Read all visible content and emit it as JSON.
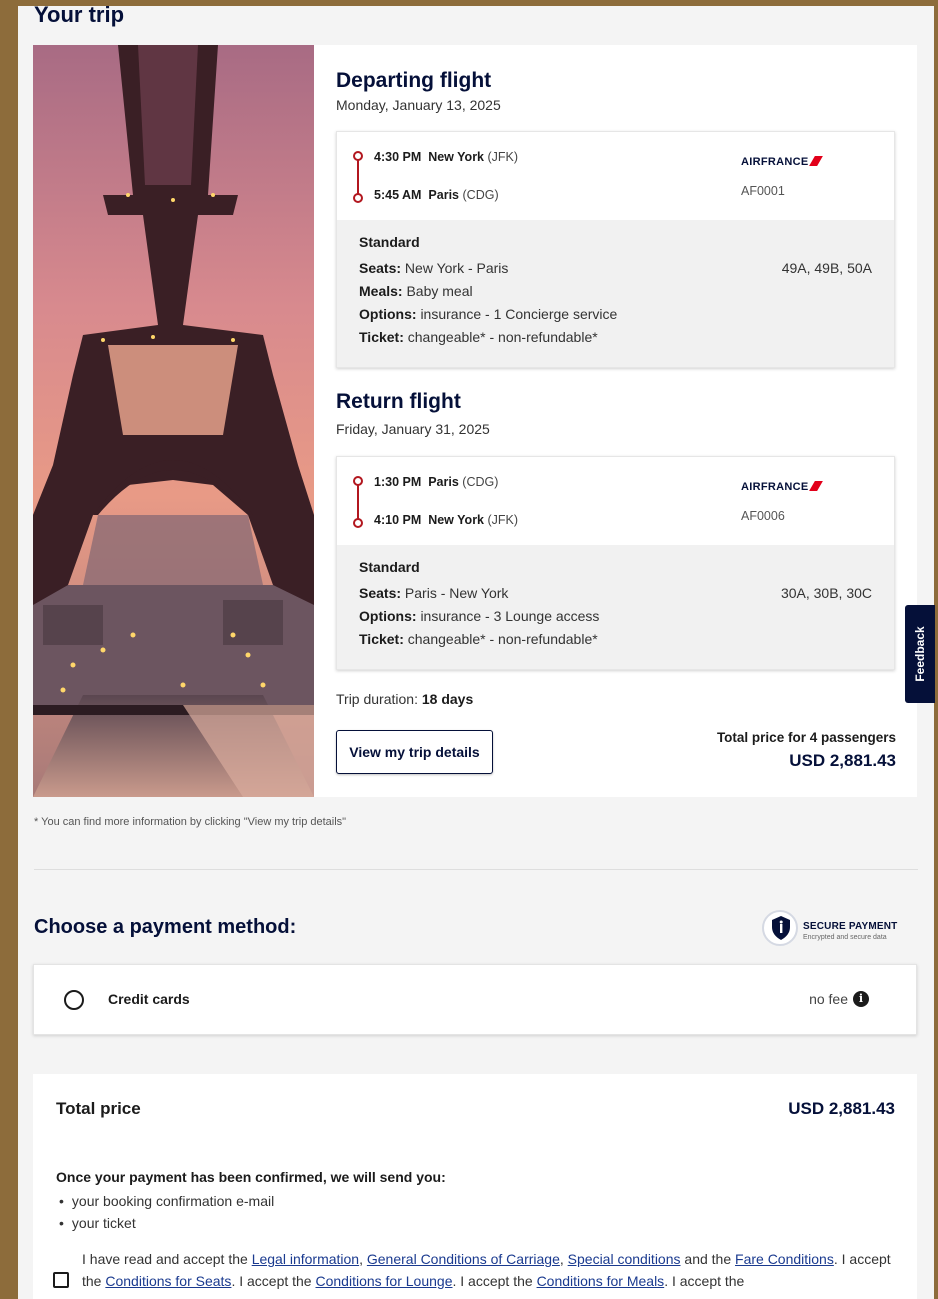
{
  "trip": {
    "section_title": "Your trip",
    "departing": {
      "heading": "Departing flight",
      "date": "Monday, January 13, 2025",
      "origin": {
        "time": "4:30 PM",
        "city": "New York",
        "code": "(JFK)"
      },
      "destination": {
        "time": "5:45 AM",
        "city": "Paris",
        "code": "(CDG)"
      },
      "airline": "AIRFRANCE",
      "flight_number": "AF0001",
      "fare_class": "Standard",
      "seats_label": "Seats:",
      "seats_route": "New York - Paris",
      "seats": "49A, 49B, 50A",
      "meals_label": "Meals:",
      "meals": "Baby meal",
      "options_label": "Options:",
      "options": "insurance - 1 Concierge service",
      "ticket_label": "Ticket:",
      "ticket": "changeable* - non-refundable*"
    },
    "return": {
      "heading": "Return flight",
      "date": "Friday, January 31, 2025",
      "origin": {
        "time": "1:30 PM",
        "city": "Paris",
        "code": "(CDG)"
      },
      "destination": {
        "time": "4:10 PM",
        "city": "New York",
        "code": "(JFK)"
      },
      "airline": "AIRFRANCE",
      "flight_number": "AF0006",
      "fare_class": "Standard",
      "seats_label": "Seats:",
      "seats_route": "Paris - New York",
      "seats": "30A, 30B, 30C",
      "options_label": "Options:",
      "options": "insurance - 3 Lounge access",
      "ticket_label": "Ticket:",
      "ticket": "changeable* - non-refundable*"
    },
    "duration_label": "Trip duration:",
    "duration_value": "18 days",
    "details_button": "View my trip details",
    "total_label": "Total price for 4 passengers",
    "total_value": "USD 2,881.43",
    "footnote": "* You can find more information by clicking \"View my trip details\""
  },
  "payment": {
    "title": "Choose a payment method:",
    "secure_title": "SECURE PAYMENT",
    "secure_subtitle": "Encrypted and secure data",
    "method_label": "Credit cards",
    "fee_text": "no fee",
    "info_glyph": "i"
  },
  "summary": {
    "total_label": "Total price",
    "total_value": "USD 2,881.43",
    "confirm_intro": "Once your payment has been confirmed, we will send you:",
    "confirm_items": [
      "your booking confirmation e-mail",
      "your ticket"
    ],
    "terms": {
      "t1": "I have read and accept the ",
      "legal": "Legal information",
      "sep1": ", ",
      "carriage": "General Conditions of Carriage",
      "sep2": ", ",
      "special": "Special conditions",
      "t2": " and the ",
      "fare": "Fare Conditions",
      "t3": ". I accept the ",
      "seats": "Conditions for Seats",
      "t4": ". I accept the ",
      "lounge": "Conditions for Lounge",
      "t5": ". I accept the ",
      "meals": "Conditions for Meals",
      "t6": ". I accept the"
    }
  },
  "feedback_tab": "Feedback",
  "colors": {
    "brand_navy": "#051039",
    "airfrance_red": "#e2001a",
    "timeline_red": "#b2171f",
    "link_blue": "#1a3a8f",
    "frame_brown": "#8d6c3b"
  }
}
